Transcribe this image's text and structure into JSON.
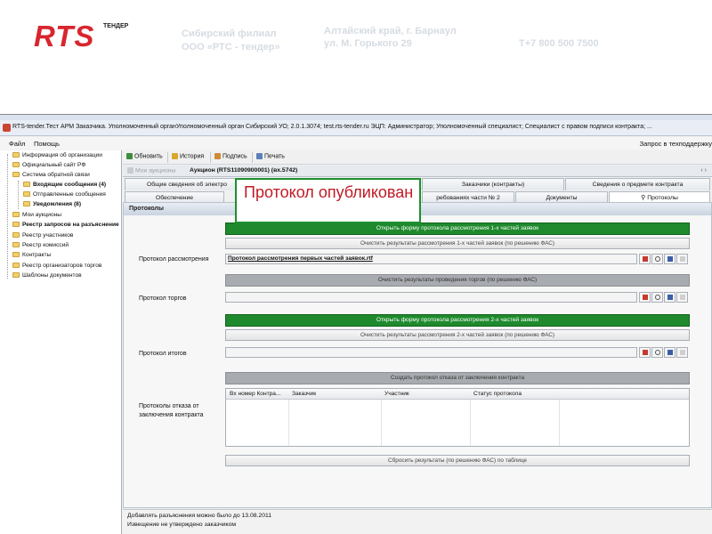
{
  "header": {
    "logo_text": "RTS",
    "logo_sub": "ТЕНДЕР",
    "branch_line1": "Сибирский филиал",
    "branch_line2": "ООО «РТС - тендер»",
    "address_line1": "Алтайский край, г. Барнаул",
    "address_line2": "ул. М. Горького 29",
    "phone": "Т+7 800 500 7500",
    "color_brand": "#d8262e"
  },
  "window": {
    "title": "RTS-tender.Тест АРМ Заказчика. Уполномоченный органУполномоченный орган Сибирский УО; 2.0.1.3074; test.rts-tender.ru ЭЦП: Администратор; Уполномоченный специалист; Специалист с правом подписи контракта; ...",
    "menu": {
      "file": "Файл",
      "help": "Помощь",
      "tech_request": "Запрос в техподдержку"
    }
  },
  "sidebar": {
    "items": [
      {
        "label": "Информация об организации"
      },
      {
        "label": "Официальный сайт РФ"
      },
      {
        "label": "Система обратной связи"
      },
      {
        "label": "Входящие сообщения (4)"
      },
      {
        "label": "Отправленные сообщения"
      },
      {
        "label": "Уведомления (8)"
      },
      {
        "label": "Мои аукционы"
      },
      {
        "label": "Реестр запросов на разъяснение"
      },
      {
        "label": "Реестр участников"
      },
      {
        "label": "Реестр комиссий"
      },
      {
        "label": "Контракты"
      },
      {
        "label": "Реестр организаторов торгов"
      },
      {
        "label": "Шаблоны документов"
      }
    ]
  },
  "toolbar": {
    "refresh": "Обновить",
    "history": "История",
    "sign": "Подпись",
    "print": "Печать"
  },
  "doc_tabs": {
    "my_auctions": "Мои аукционы",
    "current": "Аукцион (RTS11090900001) (вх.5742)"
  },
  "tabs_row1": {
    "general": "Общие сведения об электро",
    "customers": "Заказчики (контракты)",
    "subject": "Сведения о предмете контракта"
  },
  "tabs_row2": {
    "security": "Обеспечение",
    "requirements": "ребованиях части № 2",
    "documents": "Документы",
    "protocols": "Протоколы"
  },
  "panel": {
    "title": "Протоколы",
    "btn_open_first": "Открыть форму протокола рассмотрения 1-х частей заявок",
    "btn_clear_first": "Очистить результаты рассмотрения 1-х частей заявок (по решению ФАС)",
    "label_review": "Протокол рассмотрения",
    "review_value": "Протокол рассмотрения первых частей заявок.rtf",
    "btn_clear_auction": "Очистить результаты проведения торгов (по решению ФАС)",
    "label_auction": "Протокол торгов",
    "btn_open_second": "Открыть форму протокола рассмотрения 2-х частей заявок",
    "btn_clear_second": "Очистить результаты рассмотрения 2-х частей заявок (по решению ФАС)",
    "label_results": "Протокол итогов",
    "btn_create_refusal": "Создать протокол отказа от заключения контракта",
    "label_refusal": "Протоколы отказа от заключения контракта",
    "grid_headers": [
      "Вх номер Контра...",
      "Заказчик",
      "Участник",
      "Статус протокола"
    ],
    "btn_reset": "Сбросить результаты  (по решению ФАС) по таблице",
    "color_green": "#1f8a2d"
  },
  "status": {
    "line1": "Добавлять разъяснения можно было до 13.08.2011",
    "line2": "Извещение не утверждено заказчиком"
  },
  "callout": {
    "text": "Протокол опубликован",
    "color_text": "#c01a24",
    "color_border": "#1d8f2f"
  }
}
